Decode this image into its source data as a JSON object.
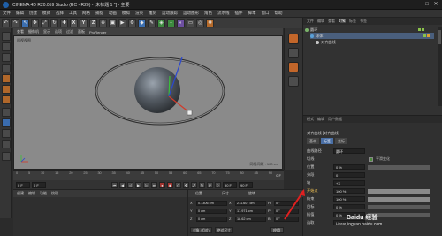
{
  "window": {
    "title": "CINEMA 4D R20.059 Studio (RC - R20) - [未标题 1 *] - 主要",
    "controls": [
      "—",
      "□",
      "✕"
    ]
  },
  "menubar": [
    "文件",
    "编辑",
    "创建",
    "模式",
    "选择",
    "工具",
    "网格",
    "捕捉",
    "动画",
    "模拟",
    "渲染",
    "雕刻",
    "运动跟踪",
    "运动图形",
    "角色",
    "流水线",
    "插件",
    "脚本",
    "窗口",
    "帮助"
  ],
  "toolbar": {
    "xyz": [
      "X",
      "Y",
      "Z"
    ],
    "icons": [
      "undo-icon",
      "redo-icon",
      "live-select-icon",
      "move-icon",
      "scale-icon",
      "rotate-icon",
      "recent-icon",
      "x-axis-icon",
      "y-axis-icon",
      "z-axis-icon",
      "coord-system-icon",
      "render-view-icon",
      "render-icon",
      "render-settings-icon",
      "cube-icon",
      "pen-icon",
      "subdivision-icon",
      "array-icon",
      "deformer-icon",
      "floor-icon",
      "camera-icon",
      "light-icon"
    ]
  },
  "viewport": {
    "menu": [
      "查看",
      "摄像机",
      "显示",
      "选项",
      "过滤",
      "面板",
      "ProRender"
    ],
    "label": "透视视图",
    "scale": "网格间距 : 100 cm"
  },
  "object_manager": {
    "tabs": [
      "文件",
      "编辑",
      "查看",
      "对象",
      "标签",
      "书签"
    ],
    "active_tab": "对象",
    "objects": [
      {
        "name": "圆环",
        "selected": false
      },
      {
        "name": "球体",
        "selected": true
      },
      {
        "name": "对齐曲线",
        "selected": false
      }
    ]
  },
  "attribute_manager": {
    "tabs": [
      "模式",
      "编辑",
      "用户数据"
    ],
    "object_name": "对齐曲线 [对齐曲线]",
    "attr_tabs": [
      "基本",
      "标签",
      "坐标"
    ],
    "active_attr_tab": "标签",
    "rows": [
      {
        "label": "曲线路径",
        "value": "圆环",
        "bar": null
      },
      {
        "label": "切线",
        "value": "",
        "bar": null
      },
      {
        "label": "位置",
        "value": "0 %",
        "bar": 0
      },
      {
        "label": "分段",
        "value": "0",
        "bar": null
      },
      {
        "label": "轴",
        "value": "+X",
        "bar": null
      },
      {
        "label": "开始点",
        "value": "100 %",
        "bar": 1.0,
        "highlight": true
      },
      {
        "label": "结束",
        "value": "100 %",
        "bar": 1.0
      },
      {
        "label": "目标",
        "value": "0 %",
        "bar": 0
      },
      {
        "label": "插值",
        "value": "0 %",
        "bar": 0
      },
      {
        "label": "选取",
        "value": "Linear",
        "bar": null
      }
    ],
    "checkbox_label": "平滑变化",
    "checkbox_on": true
  },
  "timeline": {
    "ticks": [
      "0",
      "5",
      "10",
      "15",
      "20",
      "25",
      "30",
      "35",
      "40",
      "45",
      "50",
      "55",
      "60",
      "65",
      "70",
      "75",
      "80",
      "85",
      "90"
    ],
    "end_frame": "0 F",
    "current": "0 F",
    "start": "0 F",
    "max": "90 F",
    "max2": "90 F"
  },
  "material_manager": {
    "menu": [
      "创建",
      "编辑",
      "功能",
      "纹理"
    ]
  },
  "coordinates": {
    "headers": [
      "位置",
      "尺寸",
      "旋转"
    ],
    "rows": [
      {
        "axis": "X",
        "pos": "0.1306 cm",
        "size": "211.607 cm",
        "rot_axis": "H",
        "rot": "0 °"
      },
      {
        "axis": "Y",
        "pos": "0 cm",
        "size": "17.971 cm",
        "rot_axis": "P",
        "rot": "0 °"
      },
      {
        "axis": "Z",
        "pos": "0 cm",
        "size": "18.62 cm",
        "rot_axis": "B",
        "rot": "0 °"
      }
    ],
    "mode_select": "对象 (相对)",
    "size_select": "绝对尺寸",
    "apply_label": "应用"
  },
  "watermark": {
    "main": "Baidu 经验",
    "url": "jingyan.baidu.com"
  }
}
